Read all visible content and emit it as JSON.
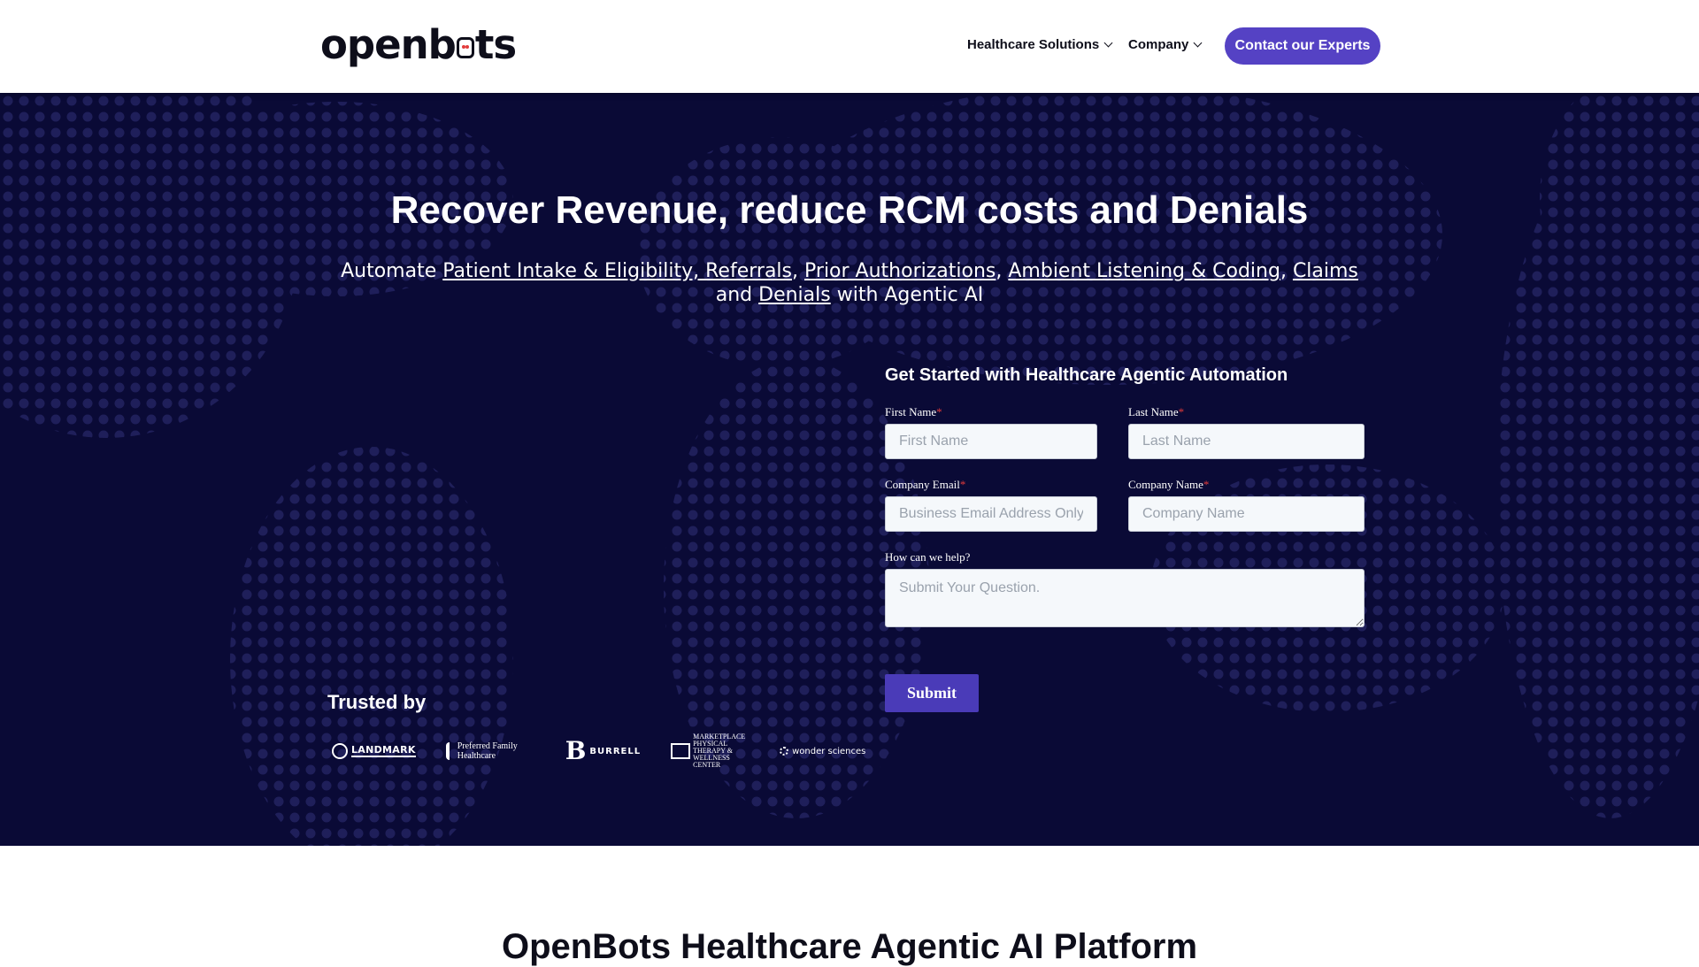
{
  "nav": {
    "logo_left": "openb",
    "logo_right": "ts",
    "menu": [
      {
        "label": "Healthcare Solutions"
      },
      {
        "label": "Company"
      }
    ],
    "cta_label": "Contact our Experts"
  },
  "hero": {
    "title": "Recover Revenue, reduce RCM costs and Denials",
    "subtitle": {
      "prefix": "Automate ",
      "link1": "Patient Intake & Eligibility, Referrals",
      "sep1": ", ",
      "link2": "Prior Authorizations",
      "sep2": ", ",
      "link3": "Ambient Listening & Coding",
      "sep3": ", ",
      "link4": "Claims",
      "and": " and ",
      "link5": "Denials",
      "suffix": " with Agentic AI"
    }
  },
  "form": {
    "title": "Get Started with Healthcare Agentic Automation",
    "first_name": {
      "label": "First Name",
      "placeholder": "First Name"
    },
    "last_name": {
      "label": "Last Name",
      "placeholder": "Last Name"
    },
    "email": {
      "label": "Company Email",
      "placeholder": "Business Email Address Only"
    },
    "company": {
      "label": "Company Name",
      "placeholder": "Company Name"
    },
    "help": {
      "label": "How can we help?",
      "placeholder": "Submit Your Question."
    },
    "required_mark": "*",
    "submit_label": "Submit"
  },
  "trusted": {
    "title": "Trusted by",
    "logos": [
      {
        "name": "LANDMARK"
      },
      {
        "name": "Preferred Family Healthcare"
      },
      {
        "initial": "B",
        "name": "BURRELL"
      },
      {
        "name": "MARKETPLACE PHYSICAL THERAPY & WELLNESS CENTER"
      },
      {
        "name": "wonder sciences"
      }
    ]
  },
  "platform": {
    "title": "OpenBots Healthcare Agentic AI Platform"
  },
  "colors": {
    "hero_bg": "#0a0a36",
    "accent": "#5542c4",
    "submit": "#4a3bb8",
    "required": "#e23b3b"
  }
}
